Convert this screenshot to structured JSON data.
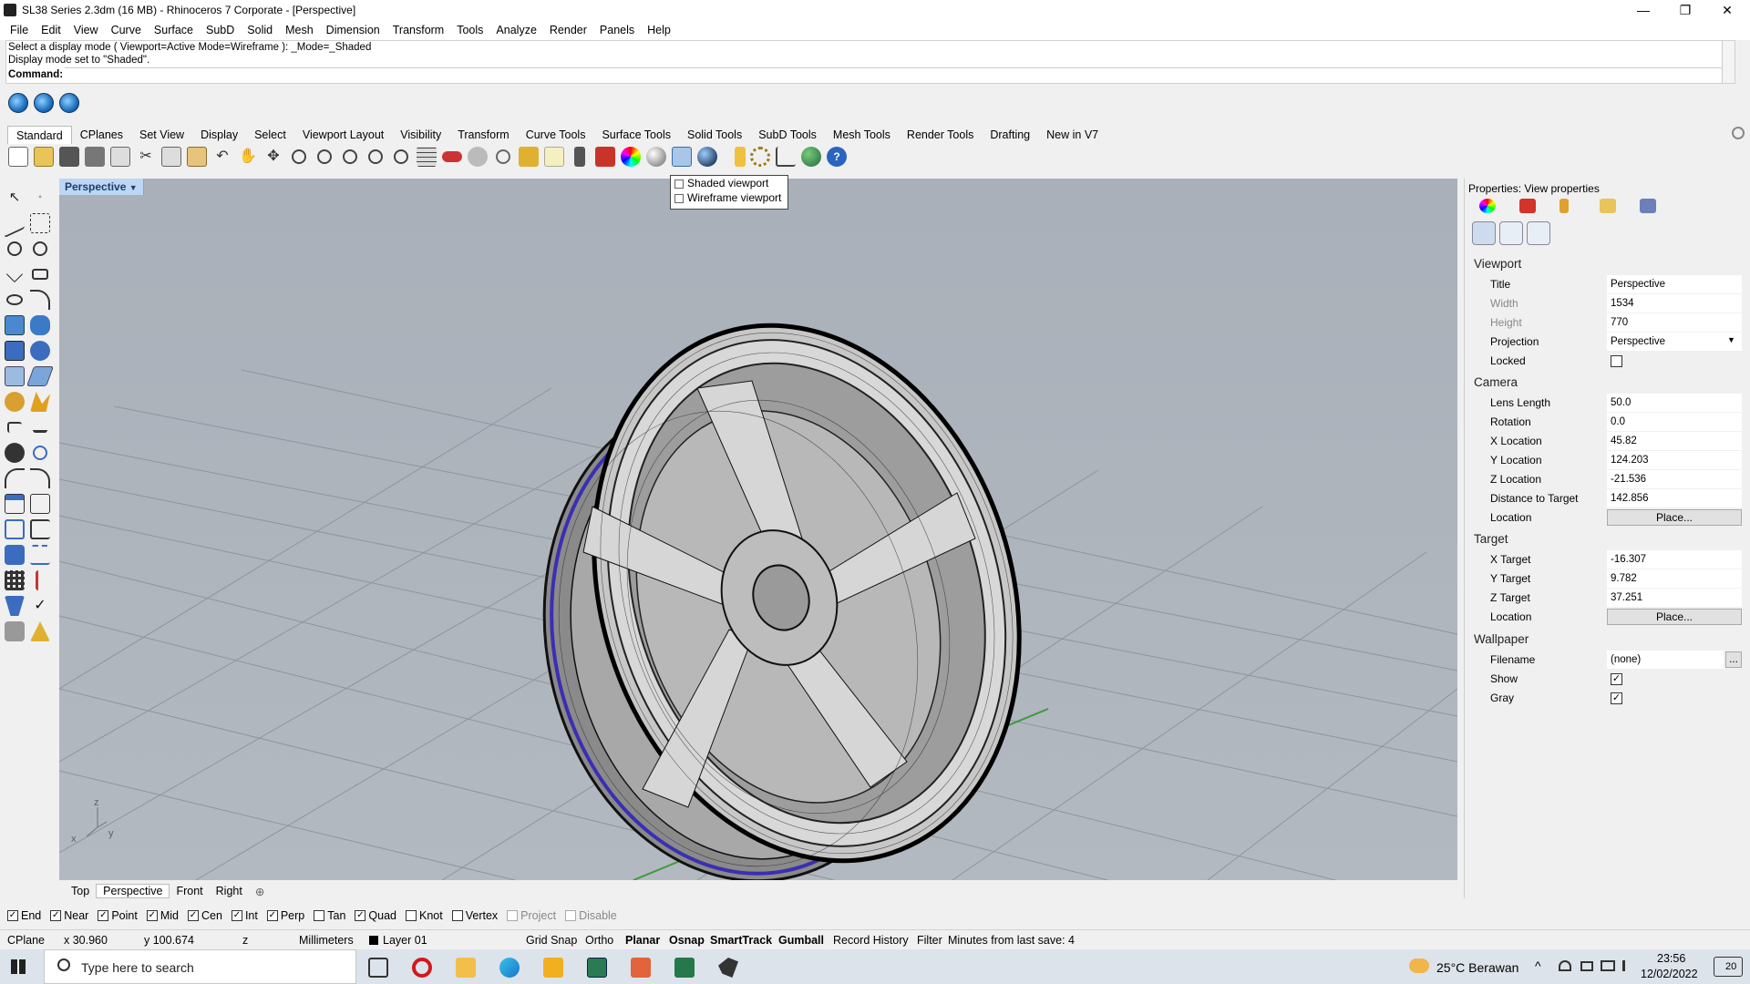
{
  "window": {
    "title": "SL38 Series 2.3dm (16 MB) - Rhinoceros 7 Corporate - [Perspective]",
    "minimize": "—",
    "maximize": "❐",
    "close": "✕"
  },
  "menu": [
    "File",
    "Edit",
    "View",
    "Curve",
    "Surface",
    "SubD",
    "Solid",
    "Mesh",
    "Dimension",
    "Transform",
    "Tools",
    "Analyze",
    "Render",
    "Panels",
    "Help"
  ],
  "command": {
    "history1": "Select a display mode ( Viewport=Active  Mode=Wireframe ): _Mode=_Shaded",
    "history2": "Display mode set to \"Shaded\".",
    "prompt": "Command:"
  },
  "toolbar_tabs": [
    "Standard",
    "CPlanes",
    "Set View",
    "Display",
    "Select",
    "Viewport Layout",
    "Visibility",
    "Transform",
    "Curve Tools",
    "Surface Tools",
    "Solid Tools",
    "SubD Tools",
    "Mesh Tools",
    "Render Tools",
    "Drafting",
    "New in V7"
  ],
  "viewport": {
    "label": "Perspective",
    "axis_x": "x",
    "axis_y": "y",
    "axis_z": "z"
  },
  "display_menu": {
    "item1": "Shaded viewport",
    "item2": "Wireframe viewport"
  },
  "properties": {
    "header": "Properties: View properties",
    "viewport_section": "Viewport",
    "title_label": "Title",
    "title_value": "Perspective",
    "width_label": "Width",
    "width_value": "1534",
    "height_label": "Height",
    "height_value": "770",
    "projection_label": "Projection",
    "projection_value": "Perspective",
    "locked_label": "Locked",
    "camera_section": "Camera",
    "lens_label": "Lens Length",
    "lens_value": "50.0",
    "rotation_label": "Rotation",
    "rotation_value": "0.0",
    "xloc_label": "X Location",
    "xloc_value": "45.82",
    "yloc_label": "Y Location",
    "yloc_value": "124.203",
    "zloc_label": "Z Location",
    "zloc_value": "-21.536",
    "dist_label": "Distance to Target",
    "dist_value": "142.856",
    "location_label": "Location",
    "place_button": "Place...",
    "target_section": "Target",
    "xt_label": "X Target",
    "xt_value": "-16.307",
    "yt_label": "Y Target",
    "yt_value": "9.782",
    "zt_label": "Z Target",
    "zt_value": "37.251",
    "tlocation_label": "Location",
    "wallpaper_section": "Wallpaper",
    "filename_label": "Filename",
    "filename_value": "(none)",
    "browse": "...",
    "show_label": "Show",
    "gray_label": "Gray"
  },
  "viewport_tabs": [
    "Top",
    "Perspective",
    "Front",
    "Right"
  ],
  "osnaps": [
    {
      "label": "End",
      "checked": true
    },
    {
      "label": "Near",
      "checked": true
    },
    {
      "label": "Point",
      "checked": true
    },
    {
      "label": "Mid",
      "checked": true
    },
    {
      "label": "Cen",
      "checked": true
    },
    {
      "label": "Int",
      "checked": true
    },
    {
      "label": "Perp",
      "checked": true
    },
    {
      "label": "Tan",
      "checked": false
    },
    {
      "label": "Quad",
      "checked": true
    },
    {
      "label": "Knot",
      "checked": false
    },
    {
      "label": "Vertex",
      "checked": false
    },
    {
      "label": "Project",
      "checked": false,
      "disabled": true
    },
    {
      "label": "Disable",
      "checked": false,
      "disabled": true
    }
  ],
  "status": {
    "cplane": "CPlane",
    "x": "x 30.960",
    "y": "y 100.674",
    "z": "z",
    "units": "Millimeters",
    "layer": "Layer 01",
    "grid_snap": "Grid Snap",
    "ortho": "Ortho",
    "planar": "Planar",
    "osnap": "Osnap",
    "smarttrack": "SmartTrack",
    "gumball": "Gumball",
    "record_history": "Record History",
    "filter": "Filter",
    "minutes": "Minutes from last save: 4"
  },
  "taskbar": {
    "search_placeholder": "Type here to search",
    "weather": "25°C  Berawan",
    "time": "23:56",
    "date": "12/02/2022",
    "notifications": "20"
  },
  "colors": {
    "viewport_bg": "#aeb5bd",
    "accent_blue": "#1c3d6e",
    "rim_blue": "#3a2fb3",
    "axis_green": "#3e9a3e"
  }
}
